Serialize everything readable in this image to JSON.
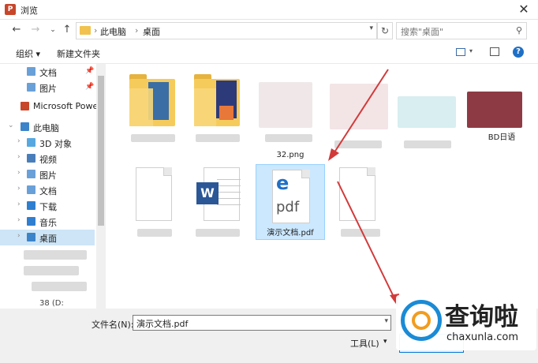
{
  "window": {
    "title": "浏览",
    "app_icon": "P"
  },
  "address": {
    "crumbs": [
      "此电脑",
      "桌面"
    ],
    "search_placeholder": "搜索\"桌面\""
  },
  "toolbar": {
    "organize": "组织 ▾",
    "new_folder": "新建文件夹"
  },
  "sidebar": {
    "items": [
      {
        "label": "文档",
        "icon": "documents-icon",
        "color": "#6aa0d8"
      },
      {
        "label": "图片",
        "icon": "pictures-icon",
        "color": "#6aa0d8"
      },
      {
        "label": "Microsoft Power",
        "icon": "powerpoint-icon",
        "color": "#c8462a"
      },
      {
        "label": "此电脑",
        "icon": "this-pc-icon",
        "color": "#3b84c9"
      },
      {
        "label": "3D 对象",
        "icon": "3d-objects-icon",
        "color": "#57a8e0"
      },
      {
        "label": "视频",
        "icon": "videos-icon",
        "color": "#4a7ebb"
      },
      {
        "label": "图片",
        "icon": "pictures-icon",
        "color": "#6aa0d8"
      },
      {
        "label": "文档",
        "icon": "documents-icon",
        "color": "#6aa0d8"
      },
      {
        "label": "下载",
        "icon": "downloads-icon",
        "color": "#2f7fd1"
      },
      {
        "label": "音乐",
        "icon": "music-icon",
        "color": "#2f7fd1"
      },
      {
        "label": "桌面",
        "icon": "desktop-icon",
        "color": "#3b84c9"
      }
    ],
    "partial_drive_label": "38 (D:"
  },
  "files": {
    "row1_labels": [
      "",
      "",
      "32.png",
      "",
      "",
      "BD日语"
    ],
    "row2_labels": [
      "",
      "",
      "演示文档.pdf",
      ""
    ],
    "pdf_text": "pdf",
    "edge_letter": "e",
    "word_letter": "W"
  },
  "footer": {
    "filename_label": "文件名(N):",
    "filename_value": "演示文档.pdf",
    "tools": "工具(L)"
  },
  "watermark": {
    "title": "查询啦",
    "url": "chaxunla.com"
  },
  "colors": {
    "accent": "#0078d7",
    "selection": "#cce8ff",
    "arrow": "#d23a3a"
  }
}
